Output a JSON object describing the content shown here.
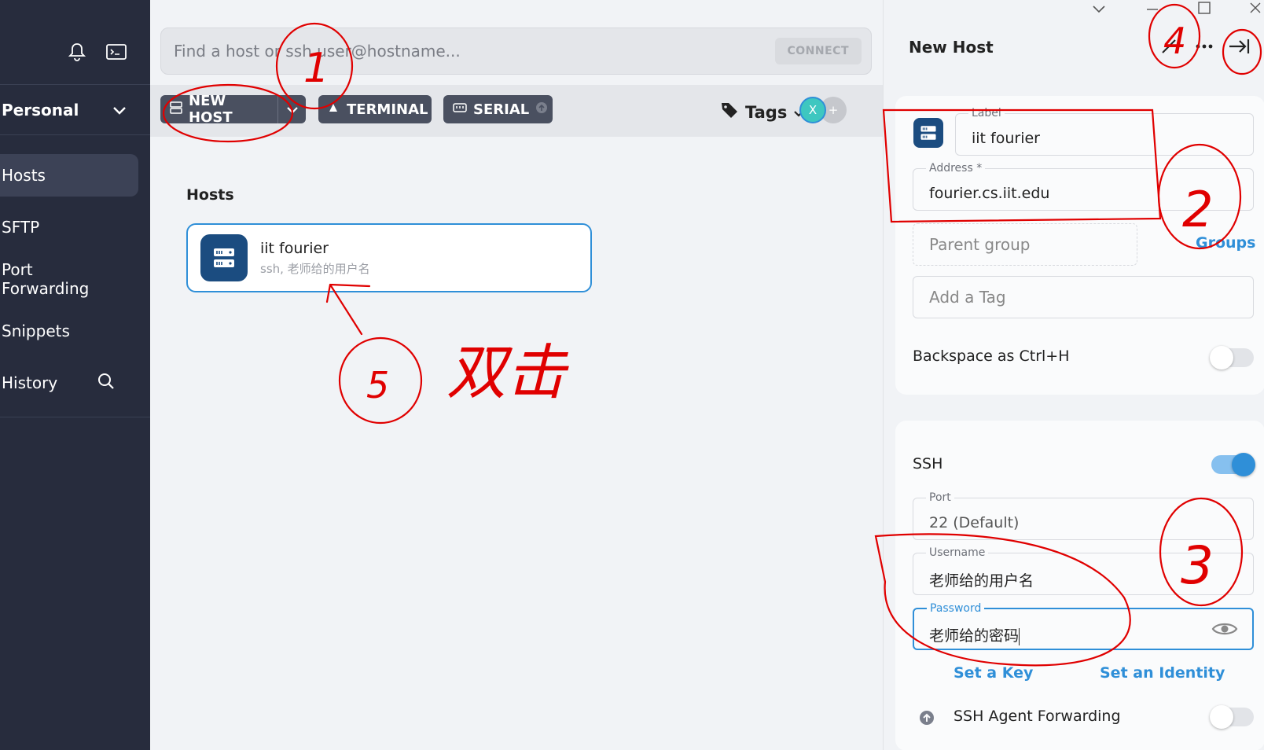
{
  "sidebar": {
    "vault": "Personal",
    "items": [
      {
        "label": "Hosts"
      },
      {
        "label": "SFTP"
      },
      {
        "label": "Port Forwarding"
      },
      {
        "label": "Snippets"
      },
      {
        "label": "History"
      }
    ]
  },
  "search": {
    "placeholder": "Find a host or ssh user@hostname...",
    "connect_label": "CONNECT"
  },
  "toolbar": {
    "new_host": "NEW HOST",
    "terminal": "TERMINAL",
    "serial": "SERIAL",
    "tags": "Tags",
    "avatar_letter": "X",
    "add": "+"
  },
  "hosts": {
    "title": "Hosts",
    "list": [
      {
        "name": "iit fourier",
        "sub": "ssh, 老师给的用户名"
      }
    ]
  },
  "panel": {
    "title": "New Host",
    "label_field": {
      "label": "Label",
      "value": "iit fourier"
    },
    "address_field": {
      "label": "Address *",
      "value": "fourier.cs.iit.edu"
    },
    "parent_group": {
      "placeholder": "Parent group"
    },
    "groups_link": "Groups",
    "tag_field": {
      "placeholder": "Add a Tag"
    },
    "backspace": "Backspace as Ctrl+H",
    "ssh": "SSH",
    "port_field": {
      "label": "Port",
      "value": "22 (Default)"
    },
    "username_field": {
      "label": "Username",
      "value": "老师给的用户名"
    },
    "password_field": {
      "label": "Password",
      "value": "老师给的密码"
    },
    "set_key": "Set a Key",
    "set_identity": "Set an Identity",
    "agent_forwarding": "SSH Agent Forwarding"
  },
  "annotations": {
    "n1": "1",
    "n2": "2",
    "n3": "3",
    "n4": "4",
    "n5": "5",
    "double_click": "双击"
  },
  "colors": {
    "accent": "#2f8fd8",
    "sidebar": "#272c3d",
    "annotation": "#e00000",
    "host_icon": "#1b4c80"
  }
}
